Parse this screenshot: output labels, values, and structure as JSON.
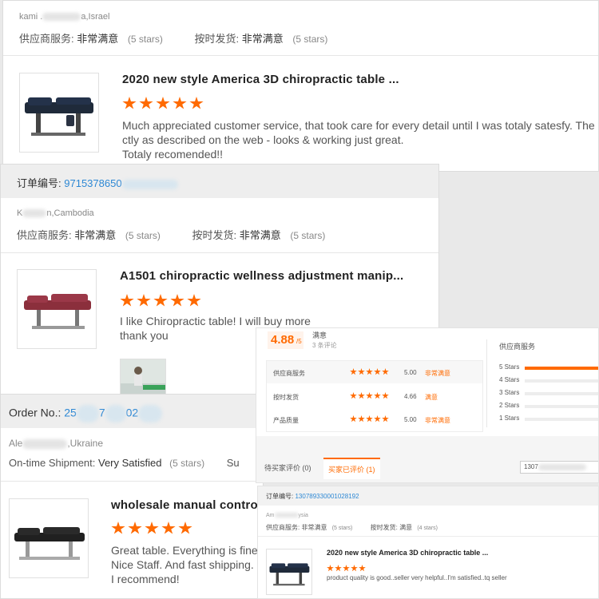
{
  "review1": {
    "reviewer": "kami .",
    "reviewer_suffix": "a,Israel",
    "supplier_service_label": "供应商服务:",
    "supplier_service_value": "非常满意",
    "supplier_service_stars": "(5 stars)",
    "shipment_label": "按时发货:",
    "shipment_value": "非常满意",
    "shipment_stars": "(5 stars)",
    "product_title": "2020 new style America 3D chiropractic table ...",
    "rating": 5,
    "comment_line1": "Much appreciated customer service, that took care for every detail until I was totaly satesfy. The be",
    "comment_line2": "ctly as described on the web - looks & working just great.",
    "comment_line3": "Totaly recomended!!"
  },
  "review2": {
    "order_label": "订单编号:",
    "order_number": "9715378650",
    "reviewer_prefix": "K",
    "reviewer_suffix": "n,Cambodia",
    "supplier_service_label": "供应商服务:",
    "supplier_service_value": "非常满意",
    "supplier_service_stars": "(5 stars)",
    "shipment_label": "按时发货:",
    "shipment_value": "非常满意",
    "shipment_stars": "(5 stars)",
    "product_title": "A1501 chiropractic wellness adjustment manip...",
    "rating": 5,
    "comment_line1": "I like Chiropractic table! I will buy more",
    "comment_line2": "thank you"
  },
  "review3": {
    "order_label": "Order No.:",
    "order_number_a": "25",
    "order_number_b": "7",
    "order_number_c": "02",
    "reviewer_prefix": "Ale",
    "reviewer_suffix": ",Ukraine",
    "shipment_label": "On-time Shipment:",
    "shipment_value": "Very Satisfied",
    "shipment_stars": "(5 stars)",
    "supplier_cut": "Su",
    "product_title": "wholesale manual control",
    "rating": 5,
    "comment_line1": "Great table. Everything is fine a",
    "comment_line2": "Nice Staff. And fast shipping.",
    "comment_line3": "I recommend!"
  },
  "summary_panel": {
    "overall_score": "4.88",
    "overall_suffix": "/5",
    "overall_text": "满意",
    "review_count": "3 条评论",
    "rows": [
      {
        "label": "供应商服务",
        "score": "5.00",
        "text": "非常满意"
      },
      {
        "label": "按时发货",
        "score": "4.66",
        "text": "满意"
      },
      {
        "label": "产品质量",
        "score": "5.00",
        "text": "非常满意"
      }
    ],
    "dist_title": "供应商服务",
    "distribution": [
      {
        "label": "5 Stars",
        "fraction": 1.0
      },
      {
        "label": "4 Stars",
        "fraction": 0.0
      },
      {
        "label": "3 Stars",
        "fraction": 0.0
      },
      {
        "label": "2 Stars",
        "fraction": 0.0
      },
      {
        "label": "1 Stars",
        "fraction": 0.0
      }
    ],
    "tab_pending": "待买家评价 (0)",
    "tab_done": "买家已评价 (1)",
    "search_value": "1307",
    "accent_color": "#ff6a00"
  },
  "review4": {
    "order_label": "订单编号:",
    "order_number": "13078933000102819​2",
    "reviewer_prefix": "Am",
    "reviewer_suffix": "ysia",
    "supplier_service_label": "供应商服务:",
    "supplier_service_value": "非常满意",
    "supplier_service_stars": "(5 stars)",
    "shipment_label": "按时发货:",
    "shipment_value": "满意",
    "shipment_stars": "(4 stars)",
    "product_title": "2020 new style America 3D chiropractic table ...",
    "rating": 5,
    "comment": "product quality is good..seller very helpful..I'm satisfied..tq seller"
  }
}
